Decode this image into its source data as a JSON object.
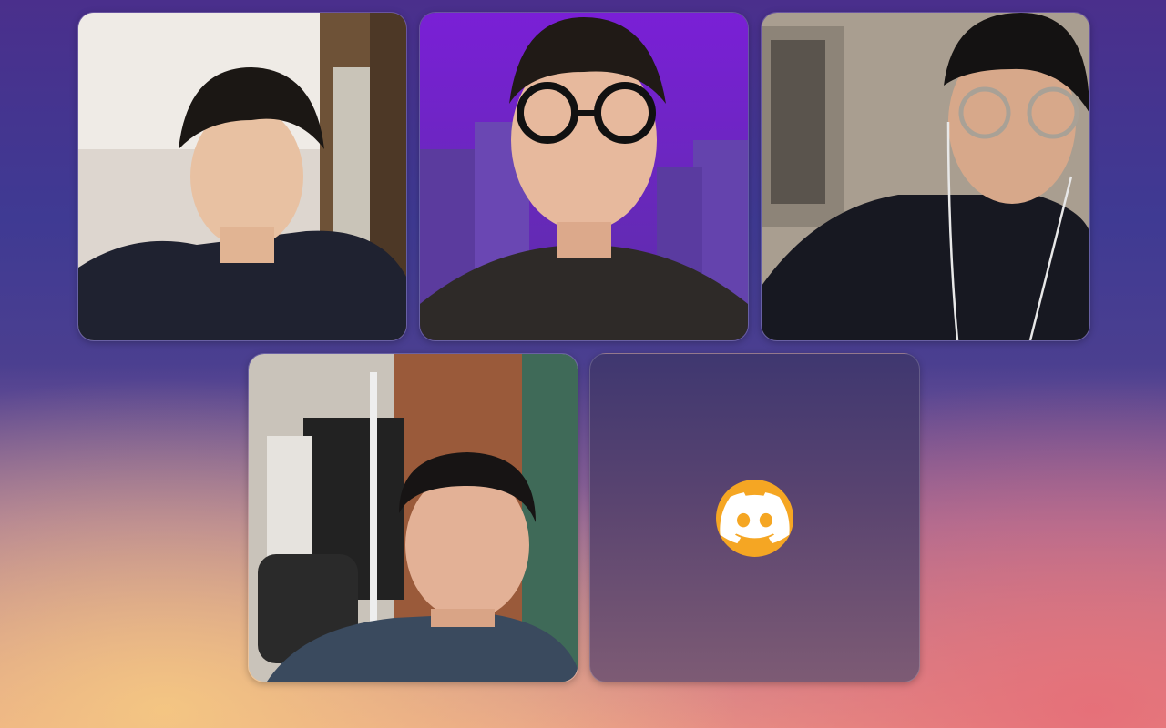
{
  "call": {
    "participants": [
      {
        "kind": "video",
        "icon": "participant-video-1"
      },
      {
        "kind": "video",
        "icon": "participant-video-2"
      },
      {
        "kind": "video",
        "icon": "participant-video-3",
        "status_icon": "deafened-icon"
      },
      {
        "kind": "video",
        "icon": "participant-video-4"
      },
      {
        "kind": "avatar",
        "icon": "discord-logo-icon",
        "avatar_color": "#f5a623"
      }
    ]
  },
  "colors": {
    "tile_border": "#ffffff",
    "discord_avatar_bg": "#f5a623",
    "discord_logo": "#ffffff"
  }
}
